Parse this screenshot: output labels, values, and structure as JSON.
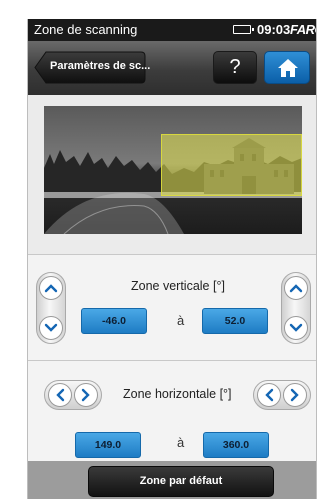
{
  "status_bar": {
    "title": "Zone de scanning",
    "time": "09:03",
    "brand": "FARO",
    "battery_icon": "battery-icon"
  },
  "nav": {
    "back_label": "Paramètres de sc...",
    "help_label": "?",
    "home_icon": "home-icon"
  },
  "vertical": {
    "label": "Zone verticale [°]",
    "from": "-46.0",
    "separator": "à",
    "to": "52.0"
  },
  "horizontal": {
    "label": "Zone horizontale [°]",
    "from": "149.0",
    "separator": "à",
    "to": "360.0"
  },
  "footer": {
    "default_label": "Zone par défaut"
  },
  "colors": {
    "accent_blue": "#1e7cc4",
    "highlight_yellow": "#e6e650",
    "bar_dark": "#1a1a1a"
  }
}
